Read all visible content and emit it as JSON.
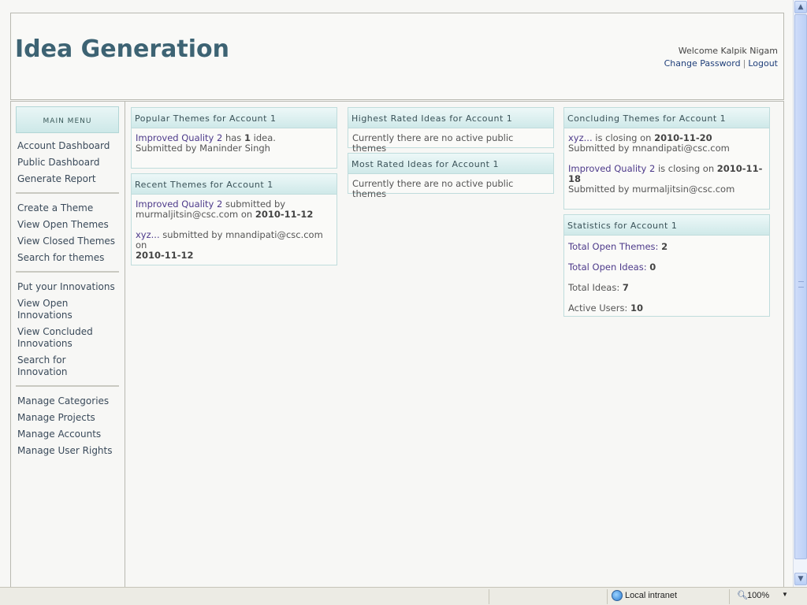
{
  "header": {
    "title": "Idea Generation",
    "welcome": "Welcome Kalpik Nigam",
    "change_password": "Change Password",
    "separator": "|",
    "logout": "Logout"
  },
  "sidebar": {
    "heading": "MAIN MENU",
    "groups": [
      [
        "Account Dashboard",
        "Public Dashboard",
        "Generate Report"
      ],
      [
        "Create a Theme",
        "View Open Themes",
        "View Closed Themes",
        "Search for themes"
      ],
      [
        "Put your Innovations",
        "View Open Innovations",
        "View Concluded Innovations",
        "Search for Innovation"
      ],
      [
        "Manage Categories",
        "Manage Projects",
        "Manage Accounts",
        "Manage User Rights"
      ]
    ]
  },
  "popular": {
    "title": "Popular Themes for Account 1",
    "theme": "Improved Quality 2",
    "has": "has",
    "count": "1",
    "idea_word": "idea.",
    "submitted_by": "Submitted by Maninder Singh"
  },
  "recent": {
    "title": "Recent Themes for Account 1",
    "entries": [
      {
        "theme": "Improved Quality 2",
        "text1": "submitted by",
        "text2": "murmaljitsin@csc.com on",
        "date": "2010-11-12"
      },
      {
        "theme": "xyz...",
        "text1": "submitted by mnandipati@csc.com on",
        "date": "2010-11-12"
      }
    ]
  },
  "highest": {
    "title": "Highest Rated Ideas for Account 1",
    "message": "Currently there are no active public themes"
  },
  "most": {
    "title": "Most Rated Ideas for Account 1",
    "message": "Currently there are no active public themes"
  },
  "concluding": {
    "title": "Concluding Themes for Account 1",
    "entries": [
      {
        "theme": "xyz...",
        "text": "is closing on",
        "date": "2010-11-20",
        "submitted": "Submitted by mnandipati@csc.com"
      },
      {
        "theme": "Improved Quality 2",
        "text": "is closing on",
        "date": "2010-11-18",
        "submitted": "Submitted by murmaljitsin@csc.com"
      }
    ]
  },
  "stats": {
    "title": "Statistics for Account 1",
    "total_open_themes_label": "Total Open Themes:",
    "total_open_themes": "2",
    "total_open_ideas_label": "Total Open Ideas:",
    "total_open_ideas": "0",
    "total_ideas_label": "Total Ideas:",
    "total_ideas": "7",
    "active_users_label": "Active Users:",
    "active_users": "10"
  },
  "statusbar": {
    "zone": "Local intranet",
    "zoom": "100%",
    "zone_icon": "globe-icon",
    "zoom_icon": "magnifier-icon"
  },
  "colors": {
    "title": "#3d6373",
    "link": "#4d3a8a",
    "panel_header": "#cfe9e9"
  }
}
